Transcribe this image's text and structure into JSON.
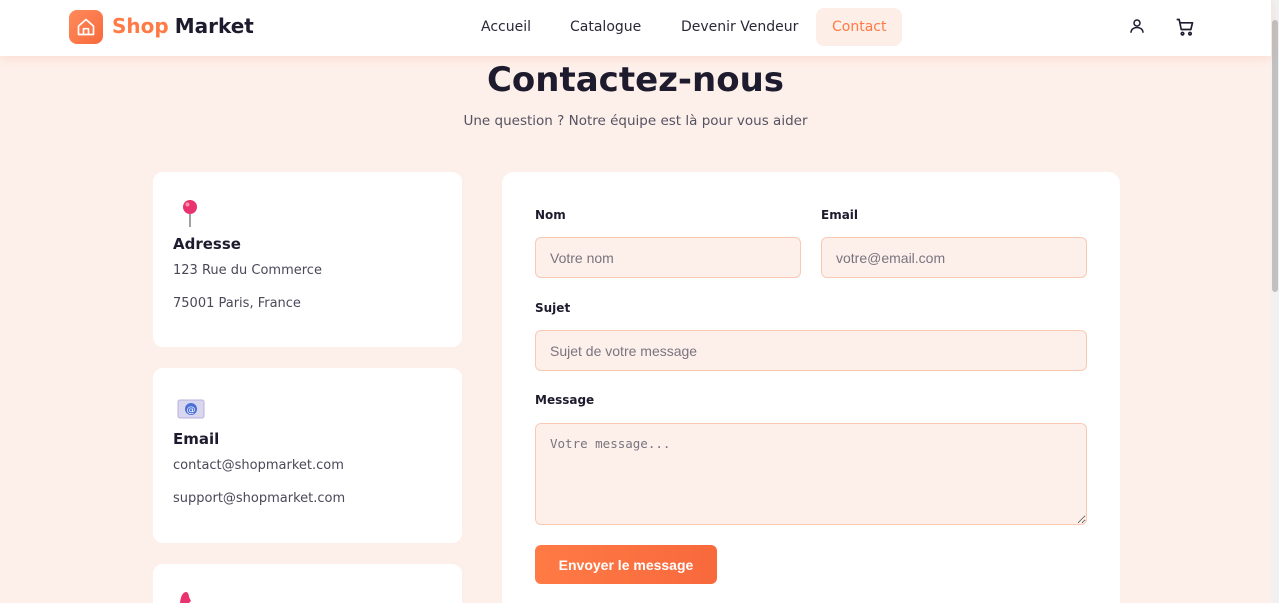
{
  "header": {
    "logo_part1": "Shop",
    "logo_part2": "Market",
    "nav": [
      {
        "label": "Accueil",
        "active": false
      },
      {
        "label": "Catalogue",
        "active": false
      },
      {
        "label": "Devenir Vendeur",
        "active": false
      },
      {
        "label": "Contact",
        "active": true
      }
    ],
    "icons": [
      "user-icon",
      "cart-icon"
    ]
  },
  "page": {
    "title": "Contactez-nous",
    "subtitle": "Une question ? Notre équipe est là pour vous aider"
  },
  "info_cards": [
    {
      "icon": "pushpin-icon",
      "title": "Adresse",
      "lines": [
        "123 Rue du Commerce",
        "75001 Paris, France"
      ]
    },
    {
      "icon": "email-icon",
      "title": "Email",
      "lines": [
        "contact@shopmarket.com",
        "support@shopmarket.com"
      ]
    },
    {
      "icon": "phone-icon",
      "title": "",
      "lines": []
    }
  ],
  "form": {
    "name_label": "Nom",
    "name_placeholder": "Votre nom",
    "email_label": "Email",
    "email_placeholder": "votre@email.com",
    "subject_label": "Sujet",
    "subject_placeholder": "Sujet de votre message",
    "message_label": "Message",
    "message_placeholder": "Votre message...",
    "submit_label": "Envoyer le message"
  },
  "colors": {
    "accent": "#ff7a45",
    "background": "#fdf0ea",
    "text": "#1e1b2e"
  }
}
